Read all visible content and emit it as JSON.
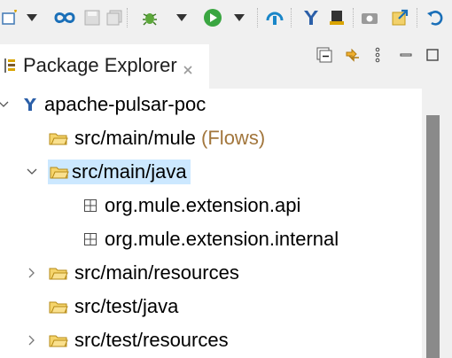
{
  "toolbar": {
    "icons": [
      "new-wizard-icon",
      "dropdown-arrow-icon",
      "mule-link-icon",
      "save-icon",
      "save-all-icon",
      "debug-icon",
      "dropdown-arrow-icon",
      "run-icon",
      "dropdown-arrow-icon",
      "publish-icon",
      "mule-logo-icon",
      "builder-icon",
      "camera-icon",
      "export-icon",
      "refresh-icon"
    ]
  },
  "view": {
    "title": "Package Explorer"
  },
  "tree": {
    "items": [
      {
        "label": "apache-pulsar-poc",
        "icon": "mule-project-icon",
        "expanded": true
      },
      {
        "label": "src/main/mule",
        "decoration": "(Flows)",
        "icon": "source-folder-icon"
      },
      {
        "label": "src/main/java",
        "icon": "source-folder-icon",
        "expanded": true,
        "selected": true
      },
      {
        "label": "org.mule.extension.api",
        "icon": "package-icon"
      },
      {
        "label": "org.mule.extension.internal",
        "icon": "package-icon"
      },
      {
        "label": "src/main/resources",
        "icon": "source-folder-icon",
        "expanded": false
      },
      {
        "label": "src/test/java",
        "icon": "source-folder-icon"
      },
      {
        "label": "src/test/resources",
        "icon": "source-folder-icon",
        "expanded": false
      }
    ]
  },
  "colors": {
    "selection": "#cce8ff",
    "decoration": "#a2763c",
    "chrome": "#f0f0f0"
  }
}
